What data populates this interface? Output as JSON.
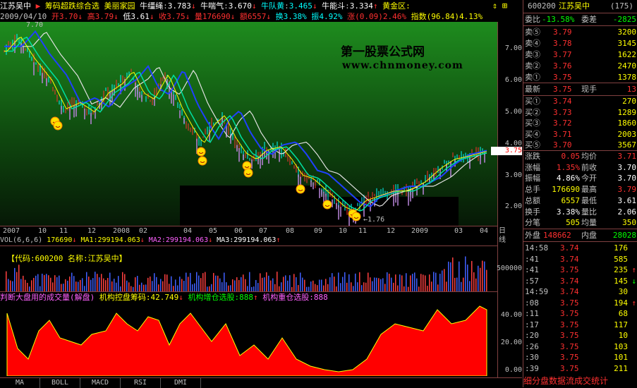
{
  "header": {
    "stock_name": "江苏吴中",
    "indicator_name": "筹码超跌综合选",
    "family_label": "美丽家园",
    "niu_jiang_label": "牛缰绳",
    "niu_jiang_value": "3.783",
    "niu_chuan_label": "牛喘气",
    "niu_chuan_value": "3.670",
    "niu_dui_label": "牛队黄",
    "niu_dui_value": "3.465",
    "niu_neng_label": "牛能斗",
    "niu_neng_value": "3.334",
    "huangjin_label": "黄金区:"
  },
  "info": {
    "date": "2009/04/10",
    "open": "开3.70",
    "high": "高3.79",
    "low": "低3.61",
    "close": "收3.75",
    "volume": "量176690",
    "amount": "额6557",
    "turnover": "换3.38%",
    "amplitude": "振4.92%",
    "change": "涨(0.09)2.46%",
    "index": "指数(96.84)4.13%"
  },
  "main_chart": {
    "high_marker": "7.70",
    "low_marker": "1.76",
    "current_tag": "3.75",
    "watermark_title": "第一股票公式网",
    "watermark_url": "www.chnmoney.com",
    "y_ticks": [
      "7.00",
      "6.00",
      "5.00",
      "4.00",
      "3.00",
      "2.00"
    ]
  },
  "date_axis": {
    "labels": [
      "2007",
      "10",
      "11",
      "12",
      "2008",
      "02",
      "04",
      "05",
      "06",
      "07",
      "08",
      "09",
      "10",
      "11",
      "12",
      "2009",
      "03",
      "04"
    ],
    "end_label": "日线"
  },
  "volume": {
    "header_label": "VOL(6,6,6)",
    "vol_value": "176690",
    "ma1": "MA1:299194.063",
    "ma2": "MA2:299194.063",
    "ma3": "MA3:299194.063",
    "code_box": "【代码:600200 名称:江苏吴中】",
    "tick": "500000"
  },
  "indicator": {
    "title": "判断大盘用的成交量(解盘)",
    "control_label": "机构控盘筹码:42.749",
    "add_label": "机构增仓选股:888",
    "heavy_label": "机构重仓选股:888",
    "ticks": [
      "40.00",
      "20.00",
      "0.00"
    ]
  },
  "bottom_tabs": [
    "MA",
    "BOLL",
    "MACD",
    "RSI",
    "DMI"
  ],
  "quote": {
    "code": "600200",
    "name": "江苏吴中",
    "count": "(175)",
    "weibi_label": "委比",
    "weibi_value": "-13.58%",
    "weicha_label": "委差",
    "weicha_value": "-2825",
    "asks": [
      {
        "label": "卖⑤",
        "price": "3.79",
        "qty": "3200"
      },
      {
        "label": "卖④",
        "price": "3.78",
        "qty": "3145"
      },
      {
        "label": "卖③",
        "price": "3.77",
        "qty": "1622"
      },
      {
        "label": "卖②",
        "price": "3.76",
        "qty": "2470"
      },
      {
        "label": "卖①",
        "price": "3.75",
        "qty": "1378"
      }
    ],
    "latest_label": "最新",
    "latest_value": "3.75",
    "hand_label": "现手",
    "hand_value": "13",
    "bids": [
      {
        "label": "买①",
        "price": "3.74",
        "qty": "270"
      },
      {
        "label": "买②",
        "price": "3.73",
        "qty": "1289"
      },
      {
        "label": "买③",
        "price": "3.72",
        "qty": "1860"
      },
      {
        "label": "买④",
        "price": "3.71",
        "qty": "2003"
      },
      {
        "label": "买⑤",
        "price": "3.70",
        "qty": "3567"
      }
    ],
    "stats": [
      {
        "l1": "涨跌",
        "v1": "0.05",
        "l2": "均价",
        "v2": "3.71"
      },
      {
        "l1": "涨幅",
        "v1": "1.35%",
        "l2": "前收",
        "v2": "3.70"
      },
      {
        "l1": "振幅",
        "v1": "4.86%",
        "l2": "今开",
        "v2": "3.70"
      },
      {
        "l1": "总手",
        "v1": "176690",
        "l2": "最高",
        "v2": "3.79"
      },
      {
        "l1": "总额",
        "v1": "6557",
        "l2": "最低",
        "v2": "3.61"
      },
      {
        "l1": "换手",
        "v1": "3.38%",
        "l2": "量比",
        "v2": "2.06"
      },
      {
        "l1": "分笔",
        "v1": "505",
        "l2": "均量",
        "v2": "350"
      }
    ],
    "outer_label": "外盘",
    "outer_value": "148662",
    "inner_label": "内盘",
    "inner_value": "28028",
    "ticks": [
      {
        "t": "14:58",
        "p": "3.74",
        "v": "176",
        "a": ""
      },
      {
        "t": ":41",
        "p": "3.74",
        "v": "585",
        "a": ""
      },
      {
        "t": ":41",
        "p": "3.75",
        "v": "235",
        "a": "↑"
      },
      {
        "t": ":57",
        "p": "3.74",
        "v": "145",
        "a": "↓"
      },
      {
        "t": "14:59",
        "p": "3.74",
        "v": "30",
        "a": ""
      },
      {
        "t": ":08",
        "p": "3.75",
        "v": "194",
        "a": "↑"
      },
      {
        "t": ":11",
        "p": "3.75",
        "v": "68",
        "a": ""
      },
      {
        "t": ":17",
        "p": "3.75",
        "v": "117",
        "a": ""
      },
      {
        "t": ":20",
        "p": "3.75",
        "v": "10",
        "a": ""
      },
      {
        "t": ":26",
        "p": "3.75",
        "v": "103",
        "a": ""
      },
      {
        "t": ":30",
        "p": "3.75",
        "v": "101",
        "a": ""
      },
      {
        "t": ":39",
        "p": "3.75",
        "v": "211",
        "a": ""
      }
    ],
    "bottom_label": "细分盘数据流成交统计"
  },
  "colors": {
    "up": "#ff3030",
    "down": "#00ff00",
    "bg_gradient_top": "#1e8c1e",
    "bg_gradient_bottom": "#0a2a0a",
    "volume_bar": "#3a3aff",
    "indicator_fill": "#ff0000"
  }
}
